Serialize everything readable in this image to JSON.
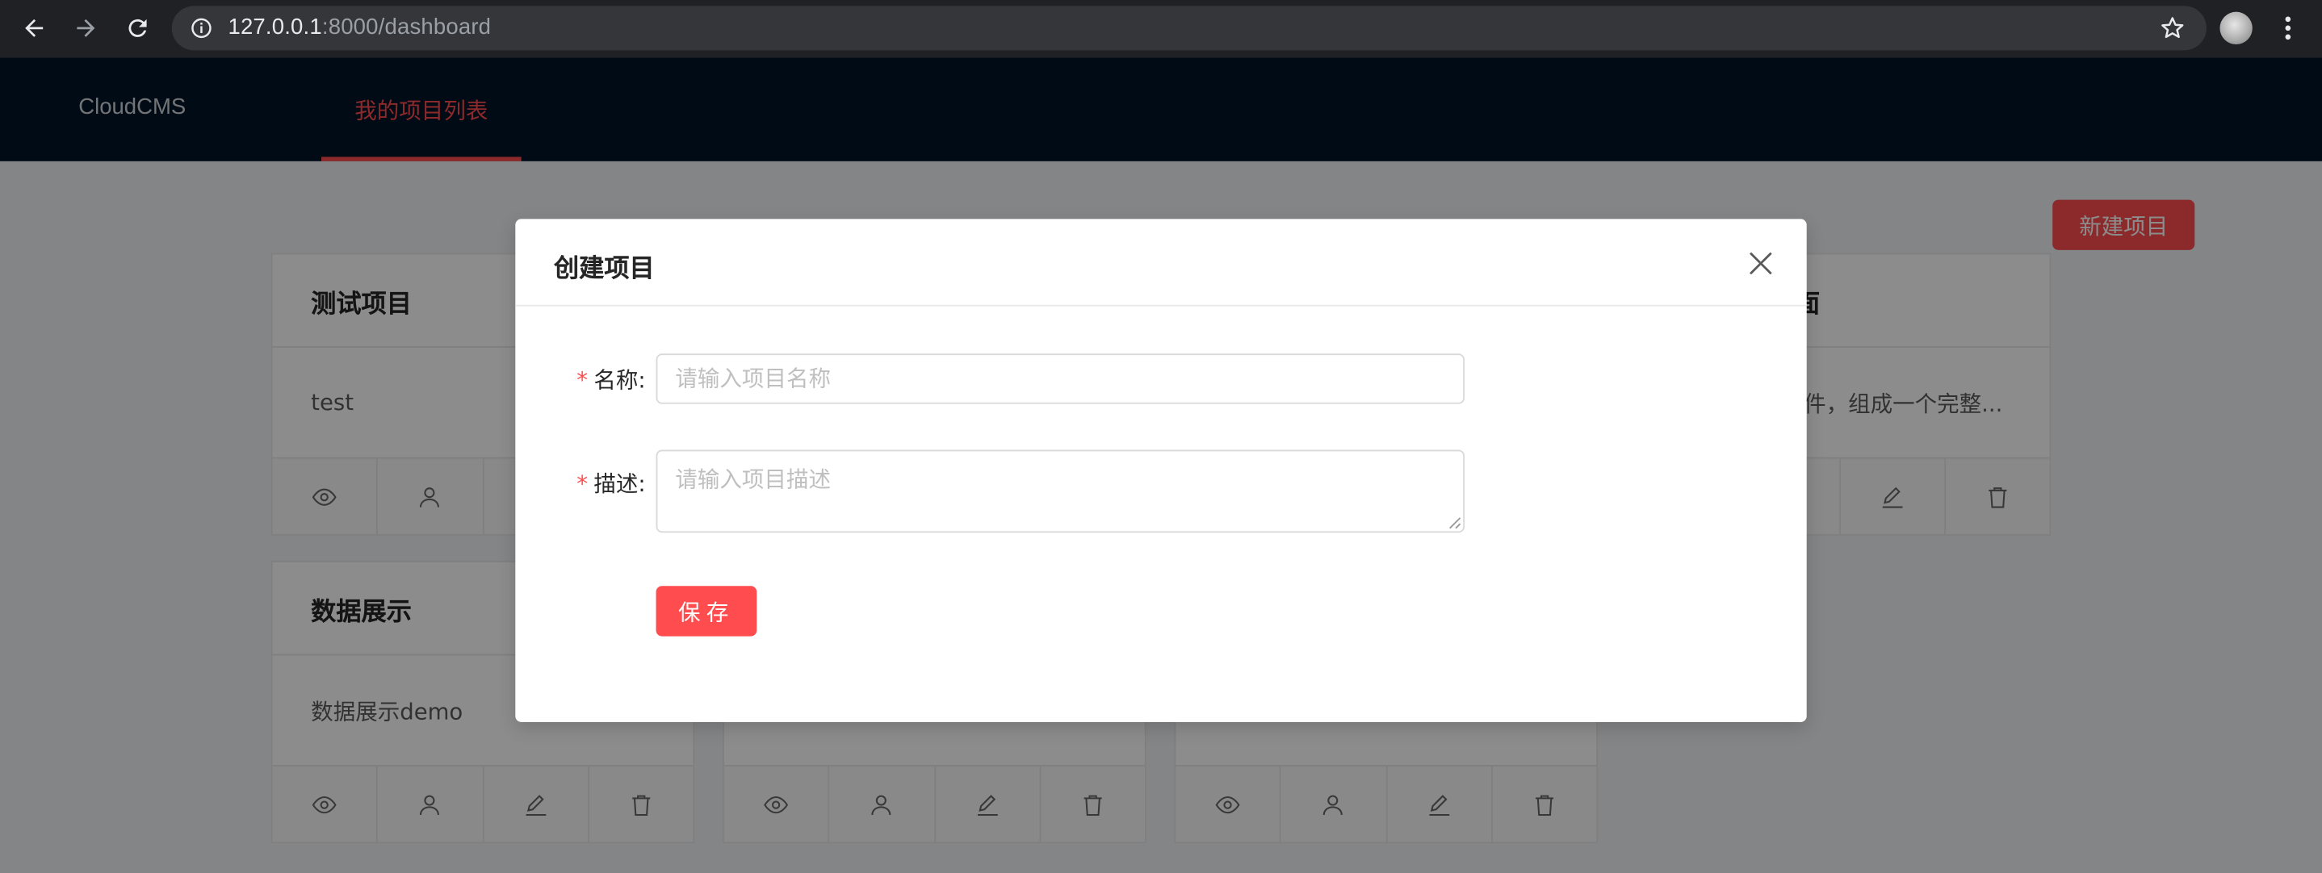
{
  "browser": {
    "url_host": "127.0.0.1",
    "url_rest": ":8000/dashboard"
  },
  "header": {
    "brand": "CloudCMS",
    "nav_active": "我的项目列表",
    "accent_color": "#ff4d4f"
  },
  "toolbar": {
    "new_project": "新建项目"
  },
  "cards": [
    {
      "title": "测试项目",
      "desc": "test"
    },
    {
      "title": "面",
      "desc": "件，组成一个完整..."
    },
    {
      "title": "数据展示",
      "desc": "数据展示demo"
    }
  ],
  "modal": {
    "title": "创建项目",
    "name_label": "名称",
    "name_placeholder": "请输入项目名称",
    "desc_label": "描述",
    "desc_placeholder": "请输入项目描述",
    "save_label": "保存",
    "required_mark": "*",
    "colon": ":"
  }
}
